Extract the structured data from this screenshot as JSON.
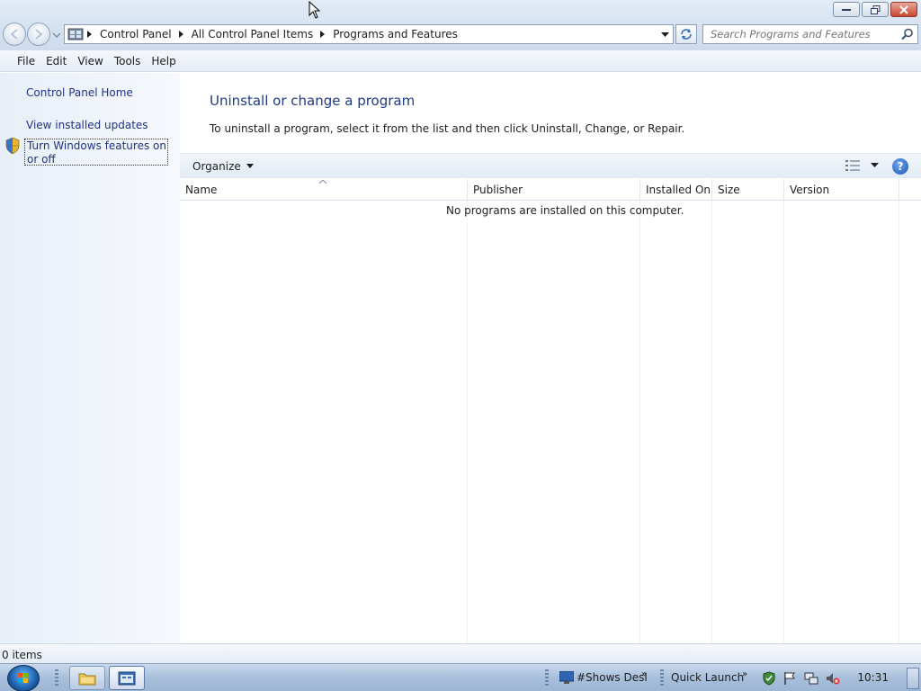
{
  "window": {
    "buttons": {
      "minimize": "minimize",
      "restore": "restore",
      "close": "close"
    }
  },
  "address_bar": {
    "crumbs": [
      "Control Panel",
      "All Control Panel Items",
      "Programs and Features"
    ]
  },
  "search": {
    "placeholder": "Search Programs and Features"
  },
  "menu": {
    "items": [
      "File",
      "Edit",
      "View",
      "Tools",
      "Help"
    ]
  },
  "left_pane": {
    "home": "Control Panel Home",
    "updates": "View installed updates",
    "features": "Turn Windows features on or off"
  },
  "main": {
    "title": "Uninstall or change a program",
    "description": "To uninstall a program, select it from the list and then click Uninstall, Change, or Repair.",
    "organize_label": "Organize",
    "columns": [
      "Name",
      "Publisher",
      "Installed On",
      "Size",
      "Version"
    ],
    "empty_message": "No programs are installed on this computer."
  },
  "status": {
    "items": "0 items"
  },
  "taskbar": {
    "show_desktop_label": "#Shows Desl",
    "quick_launch_label": "Quick Launch",
    "clock": "10:31"
  },
  "colors": {
    "link": "#1e3287",
    "title": "#1e3a8a",
    "chrome": "#d4e1f1"
  }
}
